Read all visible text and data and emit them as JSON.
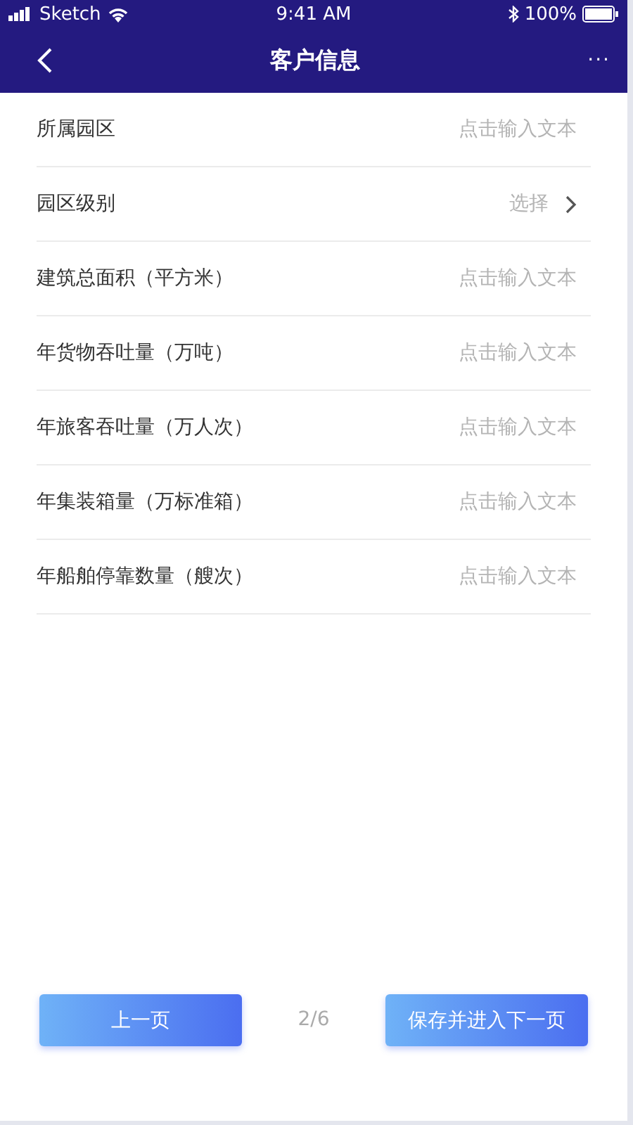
{
  "status_bar": {
    "carrier": "Sketch",
    "time": "9:41 AM",
    "battery": "100%"
  },
  "nav": {
    "title": "客户信息",
    "more": "···"
  },
  "fields": [
    {
      "kind": "input",
      "label": "所属园区",
      "placeholder": "点击输入文本"
    },
    {
      "kind": "select",
      "label": "园区级别",
      "placeholder": "选择"
    },
    {
      "kind": "input",
      "label": "建筑总面积（平方米）",
      "placeholder": "点击输入文本"
    },
    {
      "kind": "input",
      "label": "年货物吞吐量（万吨）",
      "placeholder": "点击输入文本"
    },
    {
      "kind": "input",
      "label": "年旅客吞吐量（万人次）",
      "placeholder": "点击输入文本"
    },
    {
      "kind": "input",
      "label": "年集装箱量（万标准箱）",
      "placeholder": "点击输入文本"
    },
    {
      "kind": "input",
      "label": "年船舶停靠数量（艘次）",
      "placeholder": "点击输入文本"
    }
  ],
  "footer": {
    "prev": "上一页",
    "page": "2/6",
    "next": "保存并进入下一页"
  }
}
